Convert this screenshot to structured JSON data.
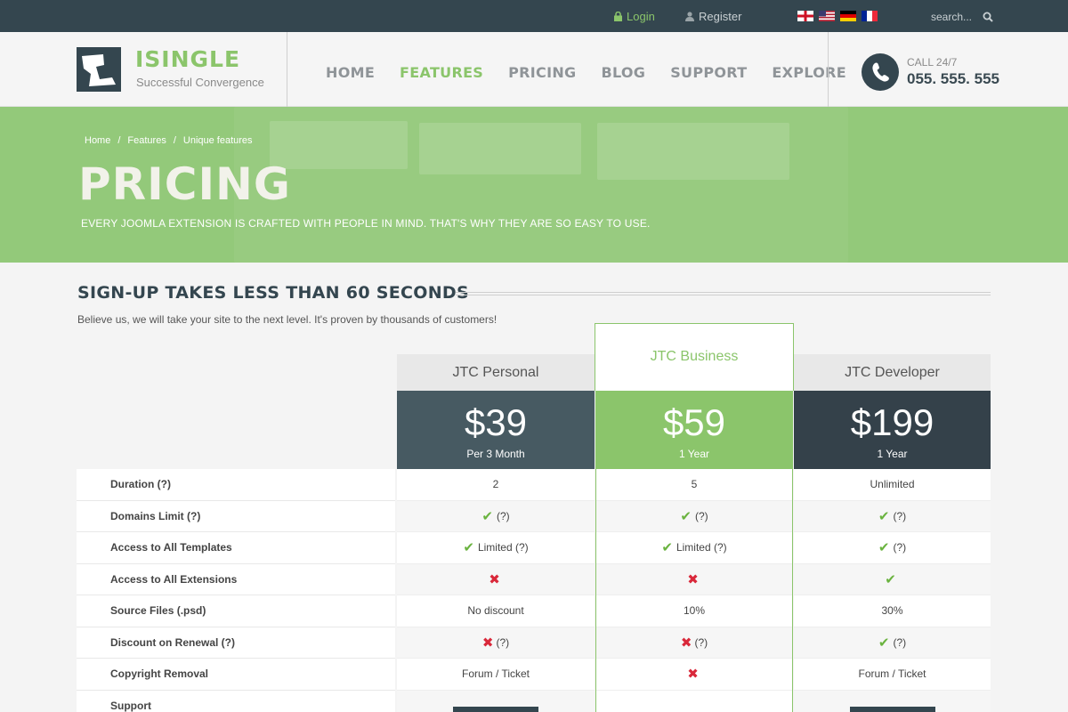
{
  "topbar": {
    "login": "Login",
    "register": "Register",
    "search_placeholder": "search...",
    "flags": [
      "england-flag",
      "usa-flag",
      "germany-flag",
      "france-flag"
    ]
  },
  "header": {
    "brand": "ISINGLE",
    "tagline": "Successful Convergence",
    "nav": [
      "HOME",
      "FEATURES",
      "PRICING",
      "BLOG",
      "SUPPORT",
      "EXPLORE"
    ],
    "active_nav": "FEATURES",
    "call_label": "CALL 24/7",
    "phone": "055. 555. 555"
  },
  "hero": {
    "breadcrumb": [
      "Home",
      "Features",
      "Unique features"
    ],
    "title": "PRICING",
    "subtitle": "EVERY JOOMLA EXTENSION IS CRAFTED WITH PEOPLE IN MIND. THAT'S WHY THEY ARE SO EASY TO USE."
  },
  "section": {
    "title": "SIGN-UP TAKES LESS THAN 60 SECONDS",
    "description": "Believe us, we will take your site to the next level. It's proven by thousands of customers!"
  },
  "colors": {
    "green": "#8bc56b",
    "dark": "#34464f",
    "personal_price_bg": "#475a62",
    "developer_price_bg": "#34414a"
  },
  "features": [
    "Duration (?)",
    "Domains Limit (?)",
    "Access to All Templates",
    "Access to All Extensions",
    "Source Files (.psd)",
    "Discount on Renewal (?)",
    "Copyright Removal",
    "Support"
  ],
  "plans": [
    {
      "name": "JTC Personal",
      "price": "$39",
      "period": "Per 3 Month",
      "cells": [
        {
          "text": "2"
        },
        {
          "icon": "check",
          "text": "(?)"
        },
        {
          "icon": "check",
          "text": "Limited (?)"
        },
        {
          "icon": "cross",
          "text": ""
        },
        {
          "text": "No discount"
        },
        {
          "icon": "cross",
          "text": "(?)"
        },
        {
          "text": "Forum / Ticket"
        }
      ]
    },
    {
      "name": "JTC Business",
      "price": "$59",
      "period": "1 Year",
      "cells": [
        {
          "text": "5"
        },
        {
          "icon": "check",
          "text": "(?)"
        },
        {
          "icon": "check",
          "text": "Limited (?)"
        },
        {
          "icon": "cross",
          "text": ""
        },
        {
          "text": "10%"
        },
        {
          "icon": "cross",
          "text": "(?)"
        },
        {
          "icon": "cross",
          "text": ""
        }
      ]
    },
    {
      "name": "JTC Developer",
      "price": "$199",
      "period": "1 Year",
      "cells": [
        {
          "text": "Unlimited"
        },
        {
          "icon": "check",
          "text": "(?)"
        },
        {
          "icon": "check",
          "text": "(?)"
        },
        {
          "icon": "check",
          "text": ""
        },
        {
          "text": "30%"
        },
        {
          "icon": "check",
          "text": "(?)"
        },
        {
          "text": "Forum / Ticket"
        }
      ]
    }
  ]
}
